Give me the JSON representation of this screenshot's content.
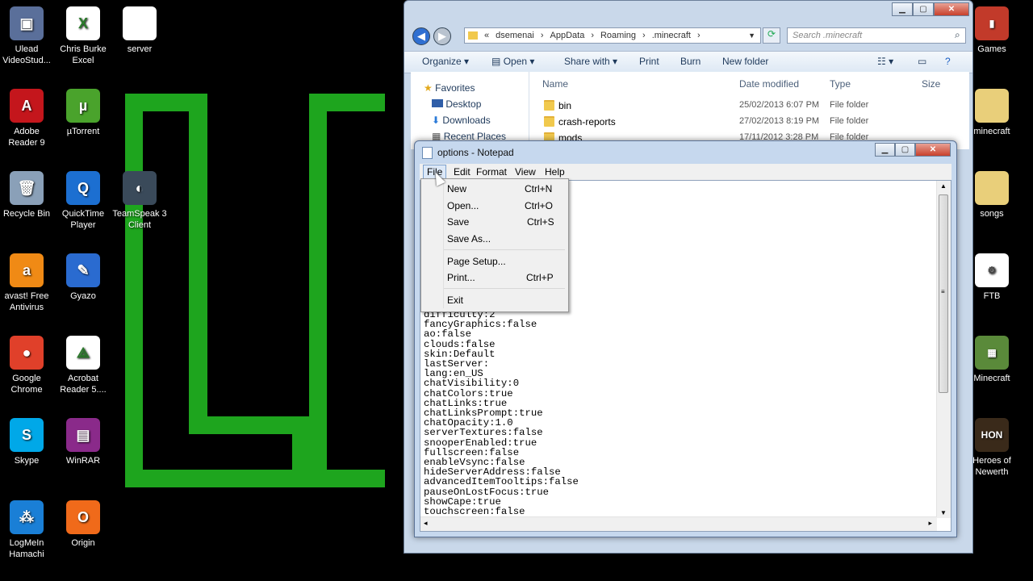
{
  "desktop": {
    "left_icons": [
      {
        "label": "Ulead VideoStud...",
        "icon": "ulead-icon",
        "color": "#5a6f9a",
        "glyph": "▣"
      },
      {
        "label": "Chris Burke Excel",
        "icon": "excel-file-icon",
        "color": "#ffffff",
        "glyph": "X"
      },
      {
        "label": "server",
        "icon": "file-icon",
        "color": "#ffffff",
        "glyph": ""
      },
      {
        "label": "Adobe Reader 9",
        "icon": "adobe-reader-icon",
        "color": "#c4161c",
        "glyph": "A"
      },
      {
        "label": "µTorrent",
        "icon": "utorrent-icon",
        "color": "#4aa32c",
        "glyph": "µ"
      },
      {
        "label": "Recycle Bin",
        "icon": "recycle-bin-icon",
        "color": "#8aa0b8",
        "glyph": "🗑"
      },
      {
        "label": "QuickTime Player",
        "icon": "quicktime-icon",
        "color": "#1c6fd1",
        "glyph": "Q"
      },
      {
        "label": "TeamSpeak 3 Client",
        "icon": "teamspeak-icon",
        "color": "#3a4a5a",
        "glyph": "◐"
      },
      {
        "label": "avast! Free Antivirus",
        "icon": "avast-icon",
        "color": "#f08a15",
        "glyph": "a"
      },
      {
        "label": "Gyazo",
        "icon": "gyazo-icon",
        "color": "#2a6bd0",
        "glyph": "✎"
      },
      {
        "label": "Google Chrome",
        "icon": "chrome-icon",
        "color": "#e0402a",
        "glyph": "●"
      },
      {
        "label": "Acrobat Reader 5....",
        "icon": "acrobat-icon",
        "color": "#ffffff",
        "glyph": "⟁"
      },
      {
        "label": "Skype",
        "icon": "skype-icon",
        "color": "#00a8e8",
        "glyph": "S"
      },
      {
        "label": "WinRAR",
        "icon": "winrar-icon",
        "color": "#8a2a8a",
        "glyph": "▤"
      },
      {
        "label": "LogMeIn Hamachi",
        "icon": "hamachi-icon",
        "color": "#1a7fd6",
        "glyph": "⁂"
      },
      {
        "label": "Origin",
        "icon": "origin-icon",
        "color": "#f06a1a",
        "glyph": "O"
      }
    ],
    "right_icons": [
      {
        "label": "Games",
        "icon": "games-folder-icon",
        "color": "#c23a2a",
        "glyph": "▮"
      },
      {
        "label": "minecraft",
        "icon": "minecraft-folder-icon",
        "color": "#e9cf7a",
        "glyph": ""
      },
      {
        "label": "songs",
        "icon": "songs-folder-icon",
        "color": "#e9cf7a",
        "glyph": ""
      },
      {
        "label": "FTB",
        "icon": "ftb-file-icon",
        "color": "#ffffff",
        "glyph": "⚙"
      },
      {
        "label": "Minecraft",
        "icon": "minecraft-icon",
        "color": "#5a8a3a",
        "glyph": "▦"
      },
      {
        "label": "Heroes of Newerth",
        "icon": "hon-icon",
        "color": "#3a2a1a",
        "glyph": "HON"
      }
    ]
  },
  "explorer": {
    "breadcrumb": [
      "«",
      "dsemenai",
      "AppData",
      "Roaming",
      ".minecraft"
    ],
    "search_placeholder": "Search .minecraft",
    "toolbar": {
      "organize": "Organize",
      "open": "Open",
      "share": "Share with",
      "print": "Print",
      "burn": "Burn",
      "new_folder": "New folder"
    },
    "nav": {
      "favorites": "Favorites",
      "desktop": "Desktop",
      "downloads": "Downloads",
      "recent": "Recent Places"
    },
    "columns": {
      "name": "Name",
      "date": "Date modified",
      "type": "Type",
      "size": "Size"
    },
    "files": [
      {
        "name": "bin",
        "date": "25/02/2013 6:07 PM",
        "type": "File folder"
      },
      {
        "name": "crash-reports",
        "date": "27/02/2013 8:19 PM",
        "type": "File folder"
      },
      {
        "name": "mods",
        "date": "17/11/2012 3:28 PM",
        "type": "File folder"
      }
    ]
  },
  "notepad": {
    "title": "options - Notepad",
    "menus": [
      "File",
      "Edit",
      "Format",
      "View",
      "Help"
    ],
    "file_menu": [
      {
        "label": "New",
        "shortcut": "Ctrl+N"
      },
      {
        "label": "Open...",
        "shortcut": "Ctrl+O"
      },
      {
        "label": "Save",
        "shortcut": "Ctrl+S"
      },
      {
        "label": "Save As...",
        "shortcut": ""
      },
      {
        "label": "Page Setup...",
        "shortcut": ""
      },
      {
        "label": "Print...",
        "shortcut": "Ctrl+P"
      },
      {
        "label": "Exit",
        "shortcut": ""
      }
    ],
    "lines": [
      "difficulty:2",
      "fancyGraphics:false",
      "ao:false",
      "clouds:false",
      "skin:Default",
      "lastServer:",
      "lang:en_US",
      "chatVisibility:0",
      "chatColors:true",
      "chatLinks:true",
      "chatLinksPrompt:true",
      "chatOpacity:1.0",
      "serverTextures:false",
      "snooperEnabled:true",
      "fullscreen:false",
      "enableVsync:false",
      "hideServerAddress:false",
      "advancedItemTooltips:false",
      "pauseOnLostFocus:true",
      "showCape:true",
      "touchscreen:false"
    ]
  },
  "colors": {
    "wallpaper_green": "#1ea51e",
    "window_frame": "#c6d8ee"
  }
}
